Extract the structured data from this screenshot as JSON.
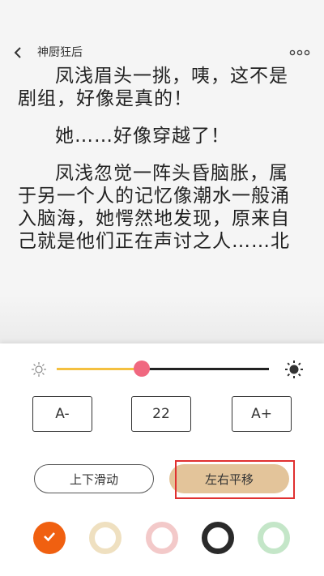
{
  "header": {
    "title": "神厨狂后",
    "back_icon": "chevron-left-icon",
    "more_icon": "more-horizontal-icon"
  },
  "content": {
    "paragraphs": [
      "凤浅眉头一挑，咦，这不是剧组，好像是真的！",
      "她……好像穿越了！",
      "凤浅忽觉一阵头昏脑胀，属于另一个人的记忆像潮水一般涌入脑海，她愕然地发现，原来自己就是他们正在声讨之人……北"
    ]
  },
  "settings": {
    "brightness": {
      "level": 0.4,
      "low_icon": "sun-small-icon",
      "high_icon": "sun-large-icon",
      "fill_color": "#f4c040",
      "thumb_color": "#f06880"
    },
    "font": {
      "decrease_label": "A-",
      "size_value": "22",
      "increase_label": "A+"
    },
    "page_mode": {
      "vertical_label": "上下滑动",
      "horizontal_label": "左右平移",
      "selected": "horizontal"
    },
    "themes": [
      {
        "name": "orange",
        "color": "#f06010",
        "selected": true
      },
      {
        "name": "beige",
        "color": "#efe0c0",
        "selected": false
      },
      {
        "name": "pink",
        "color": "#f3c9c9",
        "selected": false
      },
      {
        "name": "dark",
        "color": "#2a2a2a",
        "selected": false
      },
      {
        "name": "green",
        "color": "#c4e6c8",
        "selected": false
      }
    ]
  }
}
